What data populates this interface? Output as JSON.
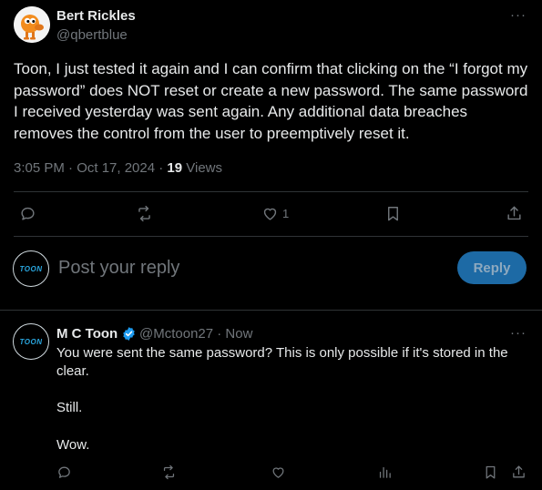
{
  "main_tweet": {
    "author_name": "Bert Rickles",
    "author_handle": "@qbertblue",
    "more_label": "···",
    "text": "Toon, I just tested it again and I can confirm that clicking on the “I forgot my password” does NOT reset or create a new password. The same password I received yesterday was sent again. Any additional data breaches removes the control from the user to preemptively reset it.",
    "timestamp": "3:05 PM · Oct 17, 2024 · ",
    "views_count": "19",
    "views_label": " Views",
    "actions": {
      "reply_icon": "reply-icon",
      "repost_icon": "repost-icon",
      "like_icon": "like-icon",
      "like_count": "1",
      "bookmark_icon": "bookmark-icon",
      "share_icon": "share-icon"
    }
  },
  "composer": {
    "avatar_text": "TOON",
    "placeholder": "Post your reply",
    "reply_button": "Reply"
  },
  "reply_tweet": {
    "avatar_text": "TOON",
    "author_name": "M C Toon",
    "verified_icon": "verified-badge-icon",
    "author_handle": "@Mctoon27 · Now",
    "more_label": "···",
    "line1": "You were sent the same password?  This is only possible if it's stored in the clear.",
    "line2": "Still.",
    "line3": "Wow.",
    "actions": [
      "reply-icon",
      "repost-icon",
      "like-icon",
      "analytics-icon",
      "bookmark-icon",
      "share-icon"
    ]
  },
  "colors": {
    "background": "#000000",
    "text_primary": "#e7e9ea",
    "text_secondary": "#71767b",
    "divider": "#2f3336",
    "accent": "#1d9bf0",
    "reply_button_bg": "#1d6aa5"
  }
}
